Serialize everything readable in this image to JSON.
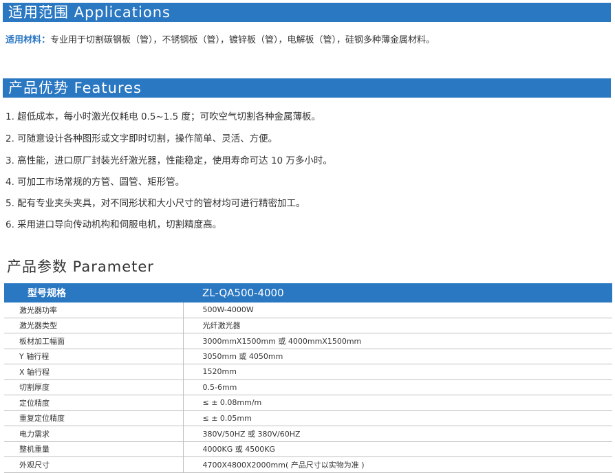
{
  "applications": {
    "title": "适用范围 Applications",
    "label": "适用材料：",
    "text": "专业用于切割碳钢板（管），不锈钢板（管），镀锌板（管），电解板（管），硅钢多种薄金属材料。"
  },
  "features": {
    "title": "产品优势 Features",
    "items": [
      "1. 超低成本，每小时激光仅耗电 0.5~1.5 度；可吹空气切割各种金属薄板。",
      "2. 可随意设计各种图形或文字即时切割，操作简单、灵活、方便。",
      "3. 高性能，进口原厂封装光纤激光器，性能稳定，使用寿命可达 10 万多小时。",
      "4. 可加工市场常规的方管、圆管、矩形管。",
      "5. 配有专业夹头夹具，对不同形状和大小尺寸的管材均可进行精密加工。",
      "6. 采用进口导向传动机构和伺服电机，切割精度高。"
    ]
  },
  "parameter": {
    "title": "产品参数 Parameter",
    "header": [
      "型号规格",
      "ZL-QA500-4000"
    ],
    "rows": [
      [
        "激光器功率",
        "500W-4000W"
      ],
      [
        "激光器类型",
        "光纤激光器"
      ],
      [
        "板材加工幅面",
        "3000mmX1500mm 或 4000mmX1500mm"
      ],
      [
        "Y 轴行程",
        "3050mm 或 4050mm"
      ],
      [
        "X 轴行程",
        "1520mm"
      ],
      [
        "切割厚度",
        "0.5-6mm"
      ],
      [
        "定位精度",
        "≤ ± 0.08mm/m"
      ],
      [
        "重复定位精度",
        "≤ ± 0.05mm"
      ],
      [
        "电力需求",
        "380V/50HZ 或 380V/60HZ"
      ],
      [
        "整机重量",
        "4000KG 或 4500KG"
      ],
      [
        "外观尺寸",
        "4700X4800X2000mm( 产品尺寸以实物为准 )"
      ]
    ]
  },
  "colors": {
    "accent": "#2a77c2",
    "text": "#333333",
    "rule": "#bfbfbf"
  }
}
